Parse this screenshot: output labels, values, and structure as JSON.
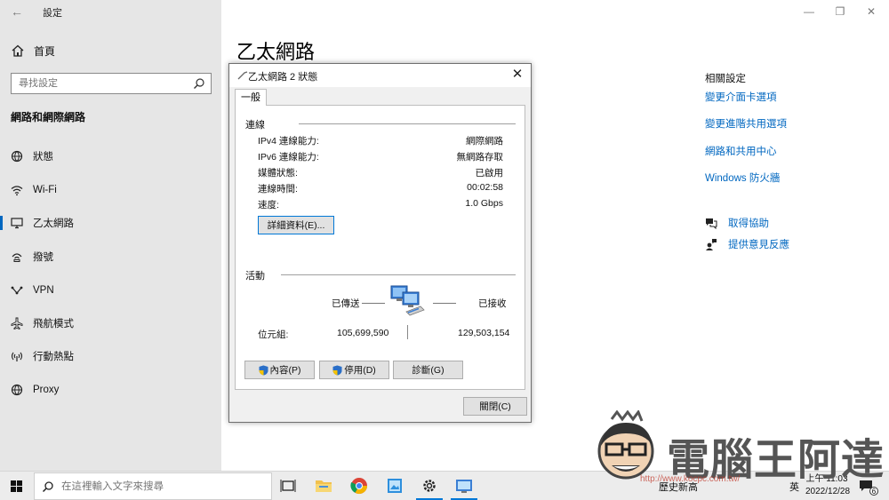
{
  "settings": {
    "app_title": "設定",
    "home_label": "首頁",
    "search_placeholder": "尋找設定",
    "section_title": "網路和網際網路",
    "nav_items": [
      {
        "label": "狀態",
        "icon": "globe-status-icon"
      },
      {
        "label": "Wi-Fi",
        "icon": "wifi-icon"
      },
      {
        "label": "乙太網路",
        "icon": "ethernet-icon",
        "active": true
      },
      {
        "label": "撥號",
        "icon": "dialup-icon"
      },
      {
        "label": "VPN",
        "icon": "vpn-icon"
      },
      {
        "label": "飛航模式",
        "icon": "airplane-icon"
      },
      {
        "label": "行動熱點",
        "icon": "hotspot-icon"
      },
      {
        "label": "Proxy",
        "icon": "globe-icon"
      }
    ],
    "page_title": "乙太網路",
    "related": {
      "heading": "相關設定",
      "links": [
        "變更介面卡選項",
        "變更進階共用選項",
        "網路和共用中心",
        "Windows 防火牆"
      ]
    },
    "help": {
      "get_help": "取得協助",
      "feedback": "提供意見反應"
    }
  },
  "dialog": {
    "title": "乙太網路 2 狀態",
    "tab": "一般",
    "connection": {
      "heading": "連線",
      "rows": [
        {
          "label": "IPv4 連線能力:",
          "value": "網際網路"
        },
        {
          "label": "IPv6 連線能力:",
          "value": "無網路存取"
        },
        {
          "label": "媒體狀態:",
          "value": "已啟用"
        },
        {
          "label": "連線時間:",
          "value": "00:02:58"
        },
        {
          "label": "速度:",
          "value": "1.0 Gbps"
        }
      ],
      "details_button": "詳細資料(E)..."
    },
    "activity": {
      "heading": "活動",
      "sent_label": "已傳送",
      "received_label": "已接收",
      "bytes_label": "位元組:",
      "bytes_sent": "105,699,590",
      "bytes_received": "129,503,154"
    },
    "buttons": {
      "properties": "內容(P)",
      "disable": "停用(D)",
      "diagnose": "診斷(G)",
      "close": "關閉(C)"
    }
  },
  "taskbar": {
    "search_placeholder": "在這裡輸入文字來搜尋",
    "news": "歷史新高",
    "ime": "英",
    "time": "上午 11:03",
    "date": "2022/12/28",
    "notification_count": "6"
  },
  "watermark": {
    "text": "電腦王阿達",
    "url": "http://www.kocpc.com.tw/"
  },
  "colors": {
    "accent": "#0067c0",
    "sidebar_bg": "#e6e6e6",
    "dialog_bg": "#f0f0f0"
  }
}
